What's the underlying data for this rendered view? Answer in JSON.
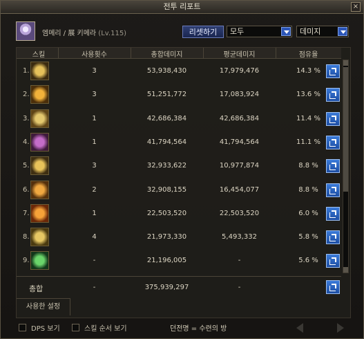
{
  "window": {
    "title": "전투 리포트"
  },
  "header": {
    "character_name": "엠메리 / 展 키메라",
    "level": "(Lv.115)",
    "reset_label": "리셋하기",
    "filter_select": "모두",
    "sort_select": "데미지"
  },
  "table": {
    "columns": [
      "스킬",
      "사용횟수",
      "총합데미지",
      "평균데미지",
      "점유율"
    ],
    "rows": [
      {
        "rank": "1.",
        "icon": "skill-icon-1",
        "uses": "3",
        "total": "53,938,430",
        "avg": "17,979,476",
        "share": "14.3 %",
        "colors": [
          "#e5c15a",
          "#3b2b10"
        ]
      },
      {
        "rank": "2.",
        "icon": "skill-icon-2",
        "uses": "3",
        "total": "51,251,772",
        "avg": "17,083,924",
        "share": "13.6 %",
        "colors": [
          "#f2b23a",
          "#4a2e0a"
        ]
      },
      {
        "rank": "3.",
        "icon": "skill-icon-3",
        "uses": "1",
        "total": "42,686,384",
        "avg": "42,686,384",
        "share": "11.4 %",
        "colors": [
          "#e3c86e",
          "#5e4416"
        ]
      },
      {
        "rank": "4.",
        "icon": "skill-icon-4",
        "uses": "1",
        "total": "41,794,564",
        "avg": "41,794,564",
        "share": "11.1 %",
        "colors": [
          "#c46cc8",
          "#3e1a3a"
        ]
      },
      {
        "rank": "5.",
        "icon": "skill-icon-5",
        "uses": "3",
        "total": "32,933,622",
        "avg": "10,977,874",
        "share": "8.8 %",
        "colors": [
          "#e8c35a",
          "#3e2e12"
        ]
      },
      {
        "rank": "6.",
        "icon": "skill-icon-6",
        "uses": "2",
        "total": "32,908,155",
        "avg": "16,454,077",
        "share": "8.8 %",
        "colors": [
          "#f0a840",
          "#54300c"
        ]
      },
      {
        "rank": "7.",
        "icon": "skill-icon-7",
        "uses": "1",
        "total": "22,503,520",
        "avg": "22,503,520",
        "share": "6.0 %",
        "colors": [
          "#f6a238",
          "#6a2808"
        ]
      },
      {
        "rank": "8.",
        "icon": "skill-icon-8",
        "uses": "4",
        "total": "21,973,330",
        "avg": "5,493,332",
        "share": "5.8 %",
        "colors": [
          "#e6c864",
          "#4a3a10"
        ]
      },
      {
        "rank": "9.",
        "icon": "skill-icon-9",
        "uses": "-",
        "total": "21,196,005",
        "avg": "-",
        "share": "5.6 %",
        "colors": [
          "#6ad46a",
          "#12361a"
        ]
      }
    ],
    "total": {
      "label": "총합",
      "uses": "-",
      "total": "375,939,297",
      "avg": "-"
    },
    "settings_label": "사용한 설정"
  },
  "footer": {
    "dps_label": "DPS 보기",
    "order_label": "스킬 순서 보기",
    "dungeon_label": "던전명 = 수련의 방"
  }
}
